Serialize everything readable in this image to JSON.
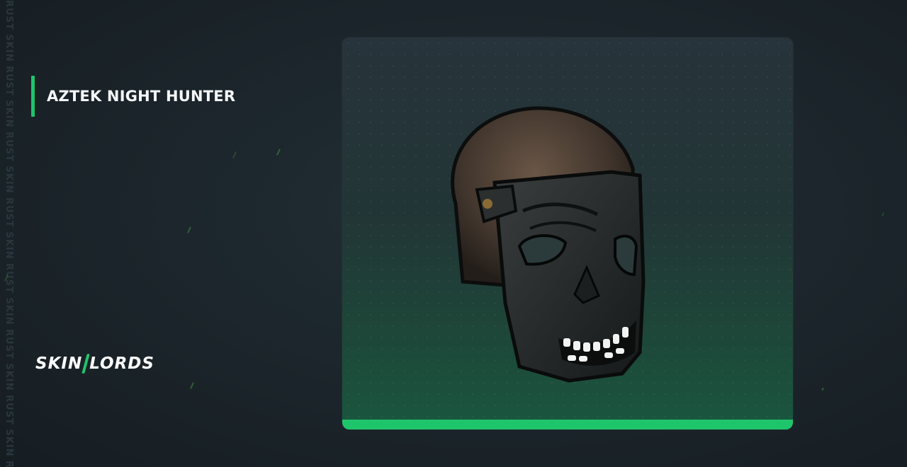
{
  "watermark": {
    "text": "RUST SKIN RUST SKIN RUST SKIN RUST SKIN RUST SKIN RUST SKIN RUST SKIN RUST"
  },
  "item": {
    "title": "AZTEK NIGHT HUNTER",
    "icon": "aztek-mask-icon"
  },
  "brand": {
    "left": "SKIN",
    "right": "LORDS",
    "accent_color": "#1fc56b"
  },
  "colors": {
    "accent": "#1fc56b",
    "background": "#1c262c"
  }
}
